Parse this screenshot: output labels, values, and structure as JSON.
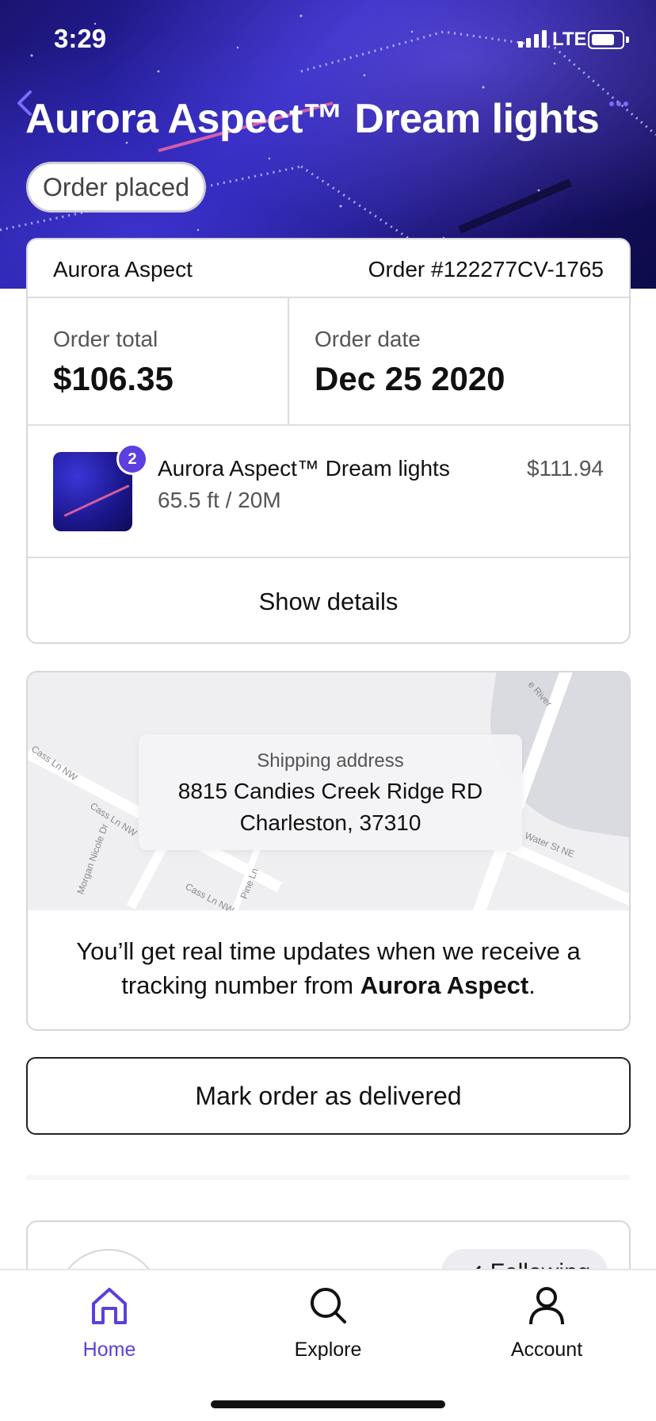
{
  "status_bar": {
    "time": "3:29",
    "network": "LTE"
  },
  "header": {
    "title": "Aurora Aspect™ Dream lights",
    "status": "Order placed"
  },
  "order": {
    "merchant": "Aurora Aspect",
    "number": "Order #122277CV-1765",
    "total_label": "Order total",
    "total": "$106.35",
    "date_label": "Order date",
    "date": "Dec 25 2020",
    "item": {
      "name": "Aurora Aspect™ Dream lights",
      "variant": "65.5 ft / 20M",
      "price": "$111.94",
      "quantity": "2"
    },
    "details_label": "Show details"
  },
  "shipping": {
    "label": "Shipping address",
    "line1": "8815 Candies Creek Ridge RD",
    "line2": "Charleston, 37310",
    "message_prefix": "You’ll get real time updates when we receive a tracking number from ",
    "message_merchant": "Aurora Aspect",
    "message_suffix": ".",
    "map_labels": [
      "Cass Ln NW",
      "Cass Ln NW",
      "Cass Ln NW",
      "Morgan Nicole Dr",
      "Pine Ln",
      "Water St NE",
      "e River",
      "Water St NE"
    ]
  },
  "actions": {
    "deliver_label": "Mark order as delivered"
  },
  "merchant_card": {
    "follow_label": "Following"
  },
  "tabs": [
    {
      "label": "Home",
      "icon": "home-icon",
      "active": true
    },
    {
      "label": "Explore",
      "icon": "search-icon",
      "active": false
    },
    {
      "label": "Account",
      "icon": "account-icon",
      "active": false
    }
  ],
  "colors": {
    "accent": "#5b3fe0",
    "hero_dark": "#1a1470",
    "border": "#d6d6dc"
  }
}
